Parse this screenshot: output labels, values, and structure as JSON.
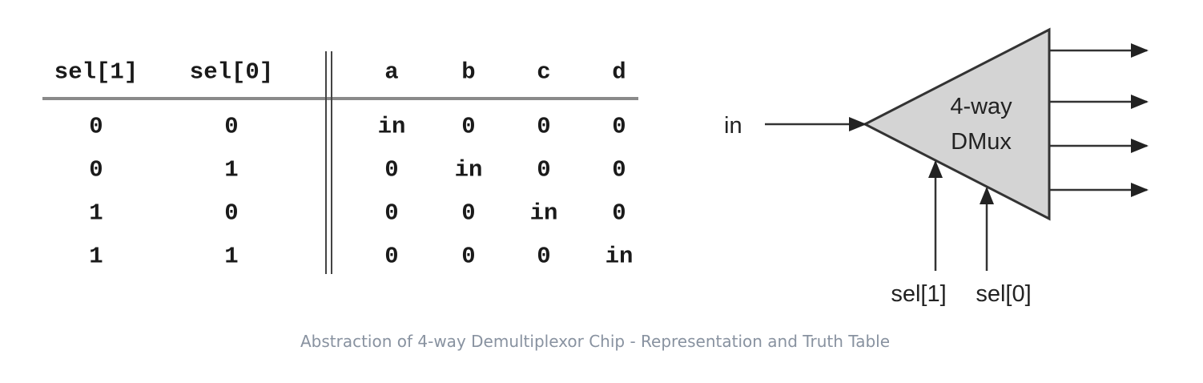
{
  "truth_table": {
    "headers": [
      "sel[1]",
      "sel[0]",
      "a",
      "b",
      "c",
      "d"
    ],
    "rows": [
      [
        "0",
        "0",
        "in",
        "0",
        "0",
        "0"
      ],
      [
        "0",
        "1",
        "0",
        "in",
        "0",
        "0"
      ],
      [
        "1",
        "0",
        "0",
        "0",
        "in",
        "0"
      ],
      [
        "1",
        "1",
        "0",
        "0",
        "0",
        "in"
      ]
    ]
  },
  "chip": {
    "input_label": "in",
    "name_line1": "4-way",
    "name_line2": "DMux",
    "sel1_label": "sel[1]",
    "sel0_label": "sel[0]",
    "fill_color": "#d4d4d4"
  },
  "caption": "Abstraction of 4-way Demultiplexor Chip - Representation and Truth Table"
}
